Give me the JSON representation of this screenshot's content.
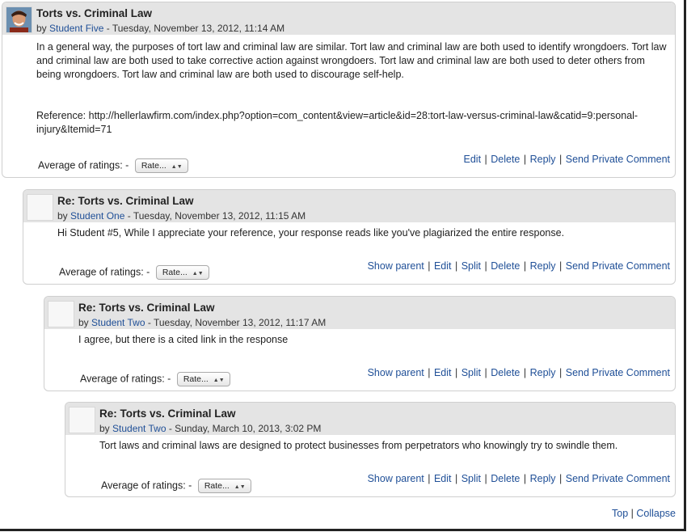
{
  "posts": [
    {
      "title": "Torts vs. Criminal Law",
      "by": "by",
      "author": "Student Five",
      "date": " - Tuesday, November 13, 2012, 11:14 AM",
      "body1": "In a general way, the purposes of tort law and criminal law are similar. Tort law and criminal law are both used to identify wrongdoers. Tort law and criminal law are both used to take corrective action against wrongdoers. Tort law and criminal law are both used to deter others from being wrongdoers. Tort law and criminal law are both used to discourage self-help.",
      "body2": "Reference:  http://hellerlawfirm.com/index.php?option=com_content&view=article&id=28:tort-law-versus-criminal-law&catid=9:personal-injury&Itemid=71",
      "rating_label": "Average of ratings: -",
      "rate": "Rate...",
      "commands": [
        "Edit",
        "Delete",
        "Reply",
        "Send Private Comment"
      ]
    },
    {
      "title": "Re: Torts vs. Criminal Law",
      "by": "by",
      "author": "Student One",
      "date": " - Tuesday, November 13, 2012, 11:15 AM",
      "body1": "Hi Student #5, While I appreciate your reference, your response reads like you've plagiarized the entire response.",
      "rating_label": "Average of ratings: -",
      "rate": "Rate...",
      "commands": [
        "Show parent",
        "Edit",
        "Split",
        "Delete",
        "Reply",
        "Send Private Comment"
      ]
    },
    {
      "title": "Re: Torts vs. Criminal Law",
      "by": "by",
      "author": "Student Two",
      "date": " - Tuesday, November 13, 2012, 11:17 AM",
      "body1": "I agree, but there is a cited link in the response",
      "rating_label": "Average of ratings: -",
      "rate": "Rate...",
      "commands": [
        "Show parent",
        "Edit",
        "Split",
        "Delete",
        "Reply",
        "Send Private Comment"
      ]
    },
    {
      "title": "Re: Torts vs. Criminal Law",
      "by": "by",
      "author": "Student Two",
      "date": " - Sunday, March 10, 2013, 3:02 PM",
      "body1": "Tort laws and criminal laws are designed to protect businesses from perpetrators who knowingly try to swindle them.",
      "rating_label": "Average of ratings: -",
      "rate": "Rate...",
      "commands": [
        "Show parent",
        "Edit",
        "Split",
        "Delete",
        "Reply",
        "Send Private Comment"
      ]
    }
  ],
  "footer": {
    "top": "Top",
    "collapse": "Collapse"
  },
  "colors": {
    "link": "#1f4f97",
    "header_bg": "#e4e4e4",
    "border": "#cfcfcf"
  }
}
